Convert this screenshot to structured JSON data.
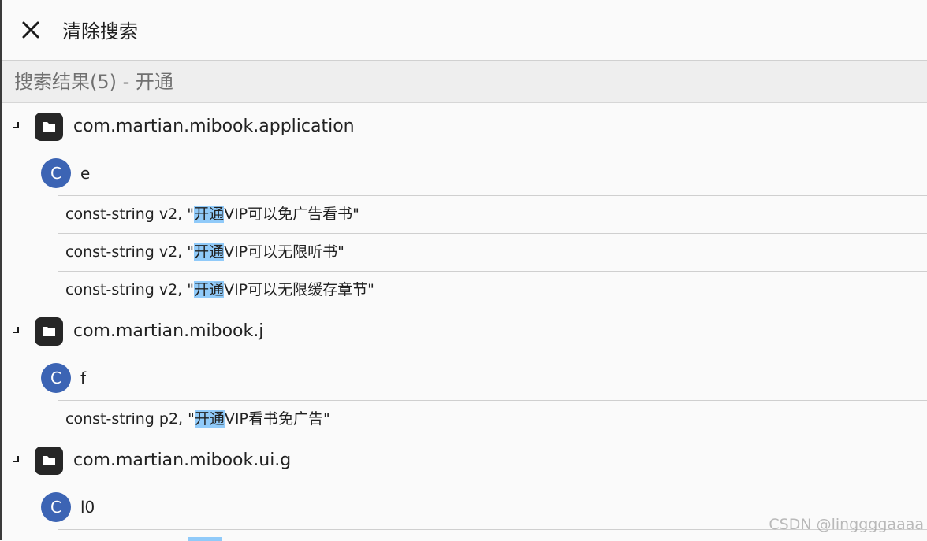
{
  "toolbar": {
    "title": "清除搜索"
  },
  "results": {
    "header": "搜索结果(5) - 开通"
  },
  "tree": {
    "packages": [
      {
        "name": "com.martian.mibook.application",
        "class_icon_letter": "C",
        "class_name": "e",
        "matches": [
          {
            "before": "const-string v2, \"",
            "hit": "开通",
            "after": "VIP可以免广告看书\""
          },
          {
            "before": "const-string v2, \"",
            "hit": "开通",
            "after": "VIP可以无限听书\""
          },
          {
            "before": "const-string v2, \"",
            "hit": "开通",
            "after": "VIP可以无限缓存章节\""
          }
        ]
      },
      {
        "name": "com.martian.mibook.j",
        "class_icon_letter": "C",
        "class_name": "f",
        "matches": [
          {
            "before": "const-string p2, \"",
            "hit": "开通",
            "after": "VIP看书免广告\""
          }
        ]
      },
      {
        "name": "com.martian.mibook.ui.g",
        "class_icon_letter": "C",
        "class_name": "l0",
        "matches": []
      }
    ]
  },
  "watermark": "CSDN @linggggaaaa",
  "colors": {
    "class_icon": "#3c64b4",
    "highlight": "#90caf9",
    "folder_icon": "#262626"
  }
}
